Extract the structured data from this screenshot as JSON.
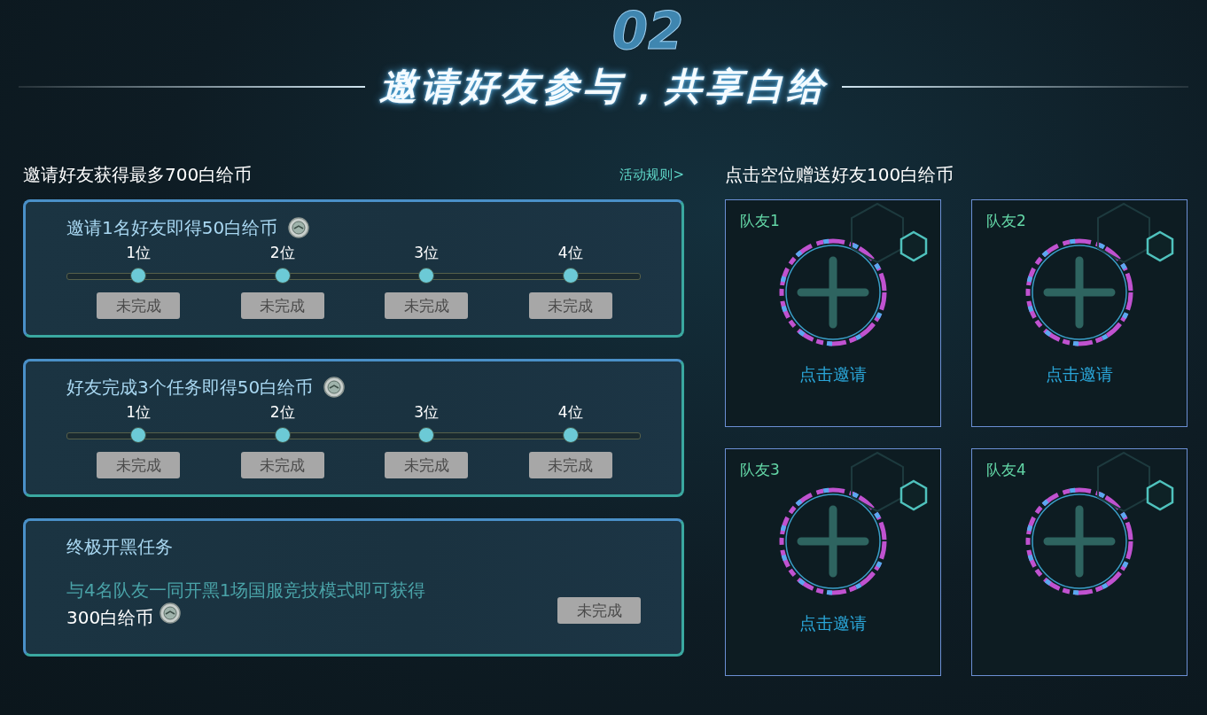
{
  "header": {
    "section_number": "02",
    "title": "邀请好友参与，共享白给"
  },
  "invite_panel": {
    "heading": "邀请好友获得最多700白给币",
    "rules_link": "活动规则>",
    "cards": [
      {
        "kind": "milestones",
        "title": "邀请1名好友即得50白给币",
        "steps": [
          {
            "label": "1位",
            "status": "未完成"
          },
          {
            "label": "2位",
            "status": "未完成"
          },
          {
            "label": "3位",
            "status": "未完成"
          },
          {
            "label": "4位",
            "status": "未完成"
          }
        ]
      },
      {
        "kind": "milestones",
        "title": "好友完成3个任务即得50白给币",
        "steps": [
          {
            "label": "1位",
            "status": "未完成"
          },
          {
            "label": "2位",
            "status": "未完成"
          },
          {
            "label": "3位",
            "status": "未完成"
          },
          {
            "label": "4位",
            "status": "未完成"
          }
        ]
      },
      {
        "kind": "final",
        "title": "终极开黑任务",
        "description": "与4名队友一同开黑1场国服竞技模式即可获得",
        "reward": "300白给币",
        "status": "未完成"
      }
    ]
  },
  "team_panel": {
    "heading": "点击空位赠送好友100白给币",
    "slots": [
      {
        "label": "队友1",
        "invite": "点击邀请"
      },
      {
        "label": "队友2",
        "invite": "点击邀请"
      },
      {
        "label": "队友3",
        "invite": "点击邀请"
      },
      {
        "label": "队友4"
      }
    ]
  }
}
